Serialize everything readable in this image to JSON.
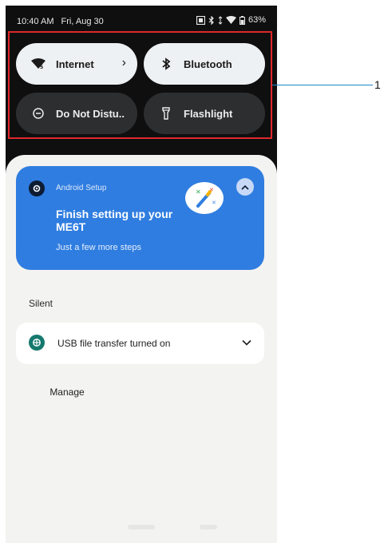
{
  "status": {
    "time": "10:40 AM",
    "date": "Fri, Aug 30",
    "battery": "63%"
  },
  "tiles": {
    "internet": {
      "label": "Internet",
      "state": "on"
    },
    "bluetooth": {
      "label": "Bluetooth",
      "state": "on"
    },
    "dnd": {
      "label": "Do Not Distu..",
      "state": "off"
    },
    "flashlight": {
      "label": "Flashlight",
      "state": "off"
    }
  },
  "callout": {
    "number": "1"
  },
  "notifications": {
    "setup": {
      "app": "Android Setup",
      "title": "Finish setting up your ME6T",
      "subtitle": "Just a few more steps"
    },
    "silent_header": "Silent",
    "usb": {
      "text": "USB file transfer turned on"
    },
    "manage_label": "Manage"
  },
  "colors": {
    "accent": "#2f7de0",
    "tile_on": "#eef1f3",
    "tile_off": "#2d2e30",
    "callout_box": "#e0282a",
    "callout_line": "#1f86c7"
  }
}
